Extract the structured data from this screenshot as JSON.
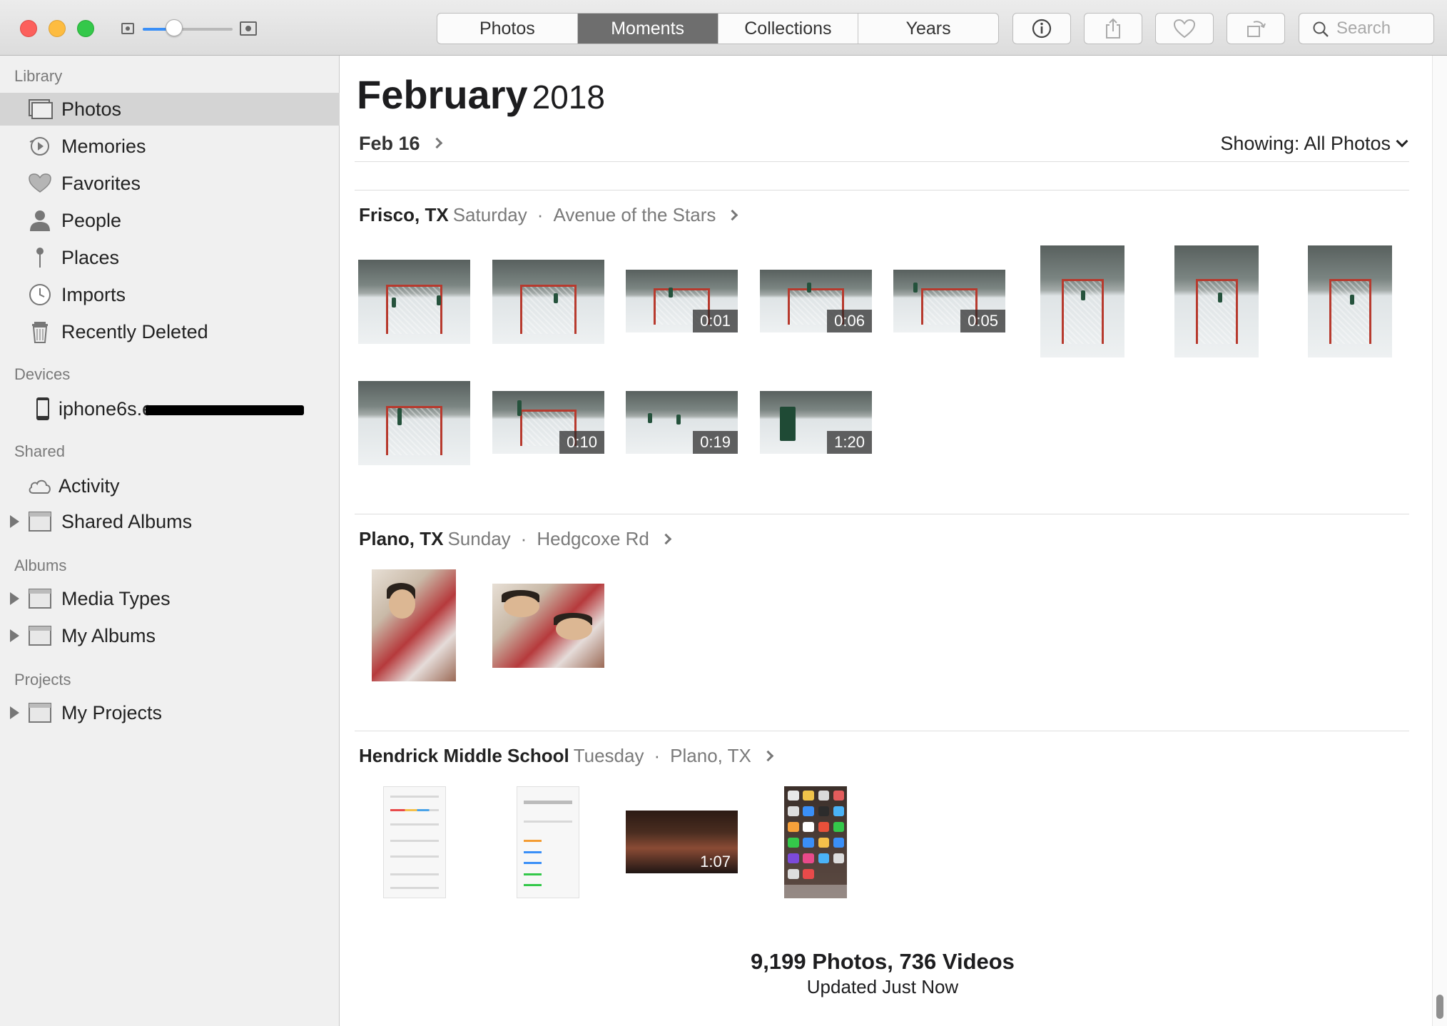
{
  "toolbar": {
    "tabs": [
      "Photos",
      "Moments",
      "Collections",
      "Years"
    ],
    "active_tab": "Moments",
    "search_placeholder": "Search"
  },
  "sidebar": {
    "library_header": "Library",
    "library_items": [
      {
        "label": "Photos",
        "icon": "photos-icon",
        "selected": true
      },
      {
        "label": "Memories",
        "icon": "memories-icon"
      },
      {
        "label": "Favorites",
        "icon": "heart-icon"
      },
      {
        "label": "People",
        "icon": "person-icon"
      },
      {
        "label": "Places",
        "icon": "pin-icon"
      },
      {
        "label": "Imports",
        "icon": "clock-icon"
      },
      {
        "label": "Recently Deleted",
        "icon": "trash-icon"
      }
    ],
    "devices_header": "Devices",
    "device_label": "iphone6s.e",
    "shared_header": "Shared",
    "shared_items": [
      {
        "label": "Activity",
        "icon": "cloud-icon"
      },
      {
        "label": "Shared Albums",
        "icon": "album-icon"
      }
    ],
    "albums_header": "Albums",
    "album_items": [
      {
        "label": "Media Types",
        "icon": "album-icon"
      },
      {
        "label": "My Albums",
        "icon": "album-icon"
      }
    ],
    "projects_header": "Projects",
    "project_items": [
      {
        "label": "My Projects",
        "icon": "album-icon"
      }
    ]
  },
  "main": {
    "title_month": "February",
    "title_year": "2018",
    "date_label": "Feb 16",
    "showing_label": "Showing: All Photos",
    "moments": [
      {
        "place": "Frisco, TX",
        "day": "Saturday",
        "sub": "Avenue of the Stars",
        "durations": [
          "",
          "",
          "0:01",
          "0:06",
          "0:05",
          "",
          "",
          "",
          "",
          "0:10",
          "0:19",
          "1:20"
        ]
      },
      {
        "place": "Plano, TX",
        "day": "Sunday",
        "sub": "Hedgcoxe Rd",
        "durations": [
          "",
          ""
        ]
      },
      {
        "place": "Hendrick Middle School",
        "day": "Tuesday",
        "sub": "Plano, TX",
        "durations": [
          "",
          "",
          "1:07",
          ""
        ]
      }
    ],
    "footer_count": "9,199 Photos, 736 Videos",
    "footer_updated": "Updated Just Now"
  },
  "colors": {
    "close": "#fc605c",
    "minimize": "#fdbc40",
    "maximize": "#34c84a",
    "active_tab_bg": "#6e6e6e",
    "sidebar_bg": "#f0f0f0",
    "selected_row": "#d4d4d4"
  }
}
